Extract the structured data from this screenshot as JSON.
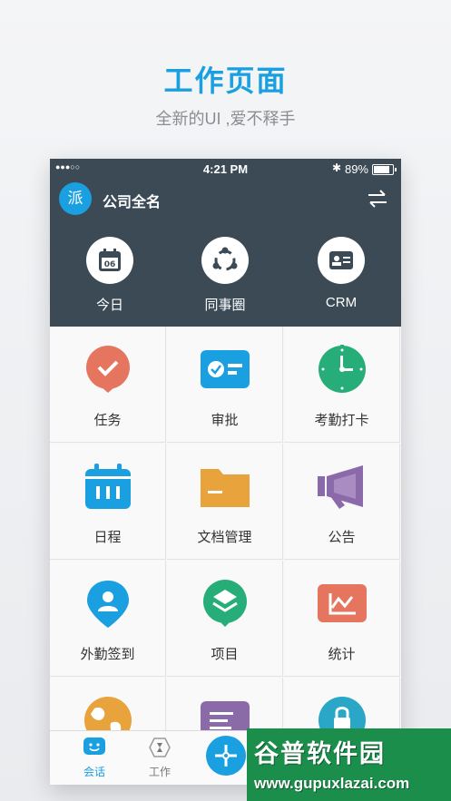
{
  "hero": {
    "title": "工作页面",
    "subtitle": "全新的UI ,爱不释手"
  },
  "status_bar": {
    "signal": "●●●○○",
    "time": "4:21 PM",
    "bluetooth": "✱",
    "battery_pct": "89%"
  },
  "header": {
    "avatar_text": "派",
    "company": "公司全名",
    "switch_icon": "swap-arrows-icon"
  },
  "quick_actions": [
    {
      "label": "今日",
      "icon": "calendar-icon",
      "date": "06"
    },
    {
      "label": "同事圈",
      "icon": "circle-share-icon"
    },
    {
      "label": "CRM",
      "icon": "contact-card-icon"
    }
  ],
  "apps": [
    {
      "label": "任务",
      "icon": "task-check-icon",
      "color": "#e5755f"
    },
    {
      "label": "审批",
      "icon": "approval-icon",
      "color": "#1aa0e0"
    },
    {
      "label": "考勤打卡",
      "icon": "clock-icon",
      "color": "#27ae78"
    },
    {
      "label": "日程",
      "icon": "schedule-icon",
      "color": "#1aa0e0"
    },
    {
      "label": "文档管理",
      "icon": "folder-icon",
      "color": "#e8a33c"
    },
    {
      "label": "公告",
      "icon": "megaphone-icon",
      "color": "#8a6aa8"
    },
    {
      "label": "外勤签到",
      "icon": "location-pin-icon",
      "color": "#1aa0e0"
    },
    {
      "label": "项目",
      "icon": "layers-icon",
      "color": "#27ae78"
    },
    {
      "label": "统计",
      "icon": "stats-chart-icon",
      "color": "#e5755f"
    },
    {
      "label": "",
      "icon": "globe-icon",
      "color": "#e8a33c"
    },
    {
      "label": "",
      "icon": "document-icon",
      "color": "#8a6aa8"
    },
    {
      "label": "",
      "icon": "lock-icon",
      "color": "#2aa7c6"
    }
  ],
  "tabbar": {
    "tabs": [
      {
        "label": "会话",
        "icon": "chat-icon",
        "active": true
      },
      {
        "label": "工作",
        "icon": "hourglass-icon",
        "active": false
      }
    ],
    "center_icon": "add-icon"
  },
  "watermark": {
    "title": "谷普软件园",
    "url": "www.gupuxlazai.com"
  },
  "colors": {
    "primary": "#1aa0e0",
    "header_bg": "#3b4a55"
  }
}
